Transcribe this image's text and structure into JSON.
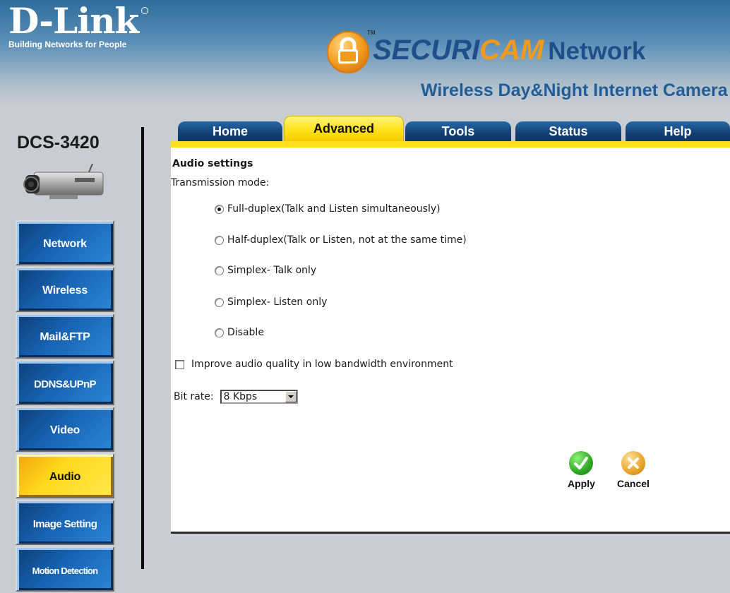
{
  "header": {
    "logo": "D-Link",
    "logo_tagline": "Building Networks for People",
    "brand_part1": "SECURI",
    "brand_part2": "CAM",
    "brand_part3": "Network",
    "trademark": "TM",
    "product_title": "Wireless Day&Night Internet Camera"
  },
  "model": "DCS-3420",
  "tabs": [
    {
      "label": "Home",
      "active": false
    },
    {
      "label": "Advanced",
      "active": true
    },
    {
      "label": "Tools",
      "active": false
    },
    {
      "label": "Status",
      "active": false
    },
    {
      "label": "Help",
      "active": false
    }
  ],
  "sidebar": {
    "items": [
      {
        "label": "Network",
        "active": false
      },
      {
        "label": "Wireless",
        "active": false
      },
      {
        "label": "Mail&FTP",
        "active": false
      },
      {
        "label": "DDNS&UPnP",
        "active": false
      },
      {
        "label": "Video",
        "active": false
      },
      {
        "label": "Audio",
        "active": true
      },
      {
        "label": "Image Setting",
        "active": false
      },
      {
        "label": "Motion Detection",
        "active": false
      }
    ]
  },
  "audio": {
    "section_title": "Audio settings",
    "transmission_label": "Transmission mode:",
    "modes": [
      {
        "label": "Full-duplex(Talk and Listen simultaneously)",
        "checked": true
      },
      {
        "label": "Half-duplex(Talk or Listen, not at the same time)",
        "checked": false
      },
      {
        "label": "Simplex- Talk only",
        "checked": false
      },
      {
        "label": "Simplex- Listen only",
        "checked": false
      },
      {
        "label": "Disable",
        "checked": false
      }
    ],
    "improve_label": "Improve audio quality in low bandwidth environment",
    "improve_checked": false,
    "bitrate_label": "Bit rate:",
    "bitrate_value": "8 Kbps"
  },
  "actions": {
    "apply_label": "Apply",
    "cancel_label": "Cancel"
  },
  "colors": {
    "active_yellow": "#ffe31c",
    "nav_blue": "#1863b3",
    "brand_orange": "#f39a1c",
    "brand_blue": "#1f4f8a"
  }
}
